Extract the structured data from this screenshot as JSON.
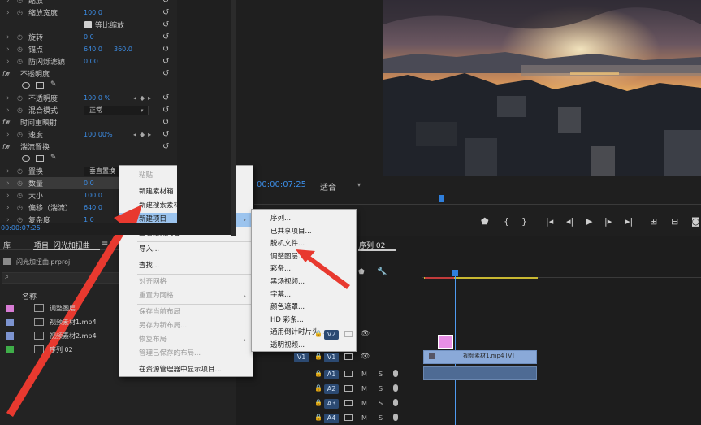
{
  "effect_controls": {
    "rows": [
      {
        "label": "缩放",
        "value": "",
        "type": "prop"
      },
      {
        "label": "缩放宽度",
        "value": "100.0",
        "type": "prop"
      },
      {
        "label": "等比缩放",
        "type": "check"
      },
      {
        "label": "旋转",
        "value": "0.0",
        "type": "prop"
      },
      {
        "label": "锚点",
        "value": "640.0",
        "value2": "360.0",
        "type": "prop"
      },
      {
        "label": "防闪烁滤镜",
        "value": "0.00",
        "type": "prop"
      },
      {
        "label": "不透明度",
        "type": "group"
      },
      {
        "label": "",
        "type": "shapes"
      },
      {
        "label": "不透明度",
        "value": "100.0 %",
        "type": "kf"
      },
      {
        "label": "混合模式",
        "dropdown": "正常",
        "type": "dropdown"
      },
      {
        "label": "时间重映射",
        "type": "group"
      },
      {
        "label": "速度",
        "value": "100.00%",
        "type": "kf"
      },
      {
        "label": "湍流置换",
        "type": "group"
      },
      {
        "label": "",
        "type": "shapes"
      },
      {
        "label": "置换",
        "dropdown": "垂直置换",
        "type": "dropdown"
      },
      {
        "label": "数量",
        "value": "0.0",
        "type": "prop"
      },
      {
        "label": "大小",
        "value": "100.0",
        "type": "prop"
      },
      {
        "label": "偏移（湍流）",
        "value": "640.0",
        "type": "prop"
      },
      {
        "label": "复杂度",
        "value": "1.0",
        "type": "prop"
      }
    ],
    "timecode": "00:00:07:25"
  },
  "program_monitor": {
    "timecode": "00:00:07:25",
    "fit": "适合"
  },
  "project": {
    "tab_left": "库",
    "tab_main": "项目: 闪光加扭曲",
    "file": "闪光加扭曲.prproj",
    "column_name": "名称",
    "items": [
      {
        "name": "调整图层",
        "color": "#d77bd4"
      },
      {
        "name": "视频素材1.mp4",
        "color": "#7d94d0"
      },
      {
        "name": "视频素材2.mp4",
        "color": "#7d94d0"
      },
      {
        "name": "序列 02",
        "color": "#3fae49"
      }
    ]
  },
  "timeline": {
    "tab": "序列 02",
    "clip_name": "视频素材1.mp4 [V]",
    "tracks": [
      {
        "name": "V2",
        "kind": "video"
      },
      {
        "name": "V1",
        "source": "V1",
        "kind": "video"
      },
      {
        "name": "A1",
        "kind": "audio"
      },
      {
        "name": "A2",
        "kind": "audio"
      },
      {
        "name": "A3",
        "kind": "audio"
      },
      {
        "name": "A4",
        "kind": "audio"
      }
    ],
    "mute": "M",
    "solo": "S"
  },
  "context_menu": {
    "items": [
      {
        "label": "粘贴",
        "disabled": true
      },
      {
        "separator": true
      },
      {
        "label": "新建素材箱"
      },
      {
        "label": "新建搜索素材箱"
      },
      {
        "label": "新建项目",
        "highlight": true,
        "submenu": true
      },
      {
        "label": "查看隐藏内容"
      },
      {
        "separator": true
      },
      {
        "label": "导入..."
      },
      {
        "separator": true
      },
      {
        "label": "查找..."
      },
      {
        "separator": true
      },
      {
        "label": "对齐网格",
        "disabled": true
      },
      {
        "label": "重置为网格",
        "disabled": true,
        "submenu": true
      },
      {
        "separator": true
      },
      {
        "label": "保存当前布局",
        "disabled": true
      },
      {
        "label": "另存为新布局...",
        "disabled": true
      },
      {
        "label": "恢复布局",
        "disabled": true,
        "submenu": true
      },
      {
        "label": "管理已保存的布局...",
        "disabled": true
      },
      {
        "separator": true
      },
      {
        "label": "在资源管理器中显示项目..."
      }
    ]
  },
  "submenu": {
    "items": [
      "序列...",
      "已共享项目...",
      "脱机文件...",
      "调整图层...",
      "彩条...",
      "黑场视频...",
      "字幕...",
      "颜色遮罩...",
      "HD 彩条...",
      "通用倒计时片头...",
      "透明视频..."
    ]
  },
  "colors": {
    "accent_blue": "#3c8de6",
    "annotation_red": "#e8392f",
    "menu_highlight": "#9cc4ee"
  }
}
